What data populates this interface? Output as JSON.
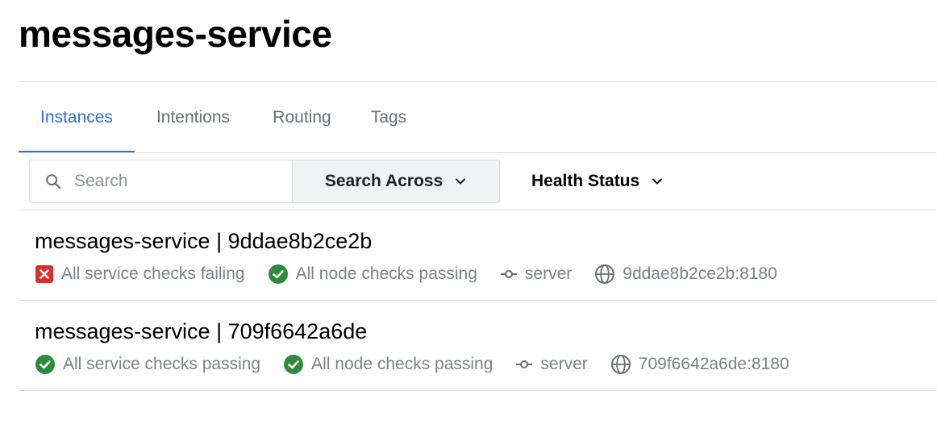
{
  "page": {
    "title": "messages-service"
  },
  "tabs": [
    {
      "label": "Instances",
      "active": true
    },
    {
      "label": "Intentions",
      "active": false
    },
    {
      "label": "Routing",
      "active": false
    },
    {
      "label": "Tags",
      "active": false
    }
  ],
  "filters": {
    "search_placeholder": "Search",
    "search_value": "",
    "search_across_label": "Search Across",
    "health_status_label": "Health Status"
  },
  "instances": [
    {
      "name": "messages-service | 9ddae8b2ce2b",
      "service_checks": {
        "status": "failing",
        "text": "All service checks failing",
        "icon": "x-square-icon"
      },
      "node_checks": {
        "status": "passing",
        "text": "All node checks passing",
        "icon": "check-circle-icon"
      },
      "node": "server",
      "address": "9ddae8b2ce2b:8180"
    },
    {
      "name": "messages-service | 709f6642a6de",
      "service_checks": {
        "status": "passing",
        "text": "All service checks passing",
        "icon": "check-circle-icon"
      },
      "node_checks": {
        "status": "passing",
        "text": "All node checks passing",
        "icon": "check-circle-icon"
      },
      "node": "server",
      "address": "709f6642a6de:8180"
    }
  ],
  "colors": {
    "accent": "#2f6fdd",
    "passing": "#2e8b3c",
    "failing": "#d5312d",
    "muted_text": "#7d808b"
  }
}
